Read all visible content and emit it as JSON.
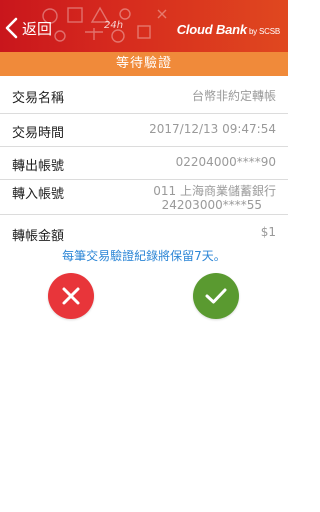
{
  "header": {
    "back_label": "返回",
    "brand_name": "Cloud Bank",
    "brand_by": "by SCSB",
    "badge": "24h",
    "colors": {
      "bar_start": "#c9161c",
      "bar_end": "#e0481f"
    }
  },
  "subheader": {
    "title": "等待驗證",
    "color": "#f08a3a"
  },
  "details": {
    "transaction_name": {
      "label": "交易名稱",
      "value": "台幣非約定轉帳"
    },
    "transaction_time": {
      "label": "交易時間",
      "value": "2017/12/13 09:47:54"
    },
    "from_account": {
      "label": "轉出帳號",
      "value": "02204000****90"
    },
    "to_account": {
      "label": "轉入帳號",
      "bank": "011 上海商業儲蓄銀行",
      "value": "24203000****55"
    },
    "amount": {
      "label": "轉帳金額",
      "value": "$1"
    }
  },
  "notice": "每筆交易驗證紀錄將保留7天。",
  "actions": {
    "reject": {
      "icon": "close-icon",
      "color": "#e8353a"
    },
    "approve": {
      "icon": "check-icon",
      "color": "#5a9a30"
    }
  }
}
